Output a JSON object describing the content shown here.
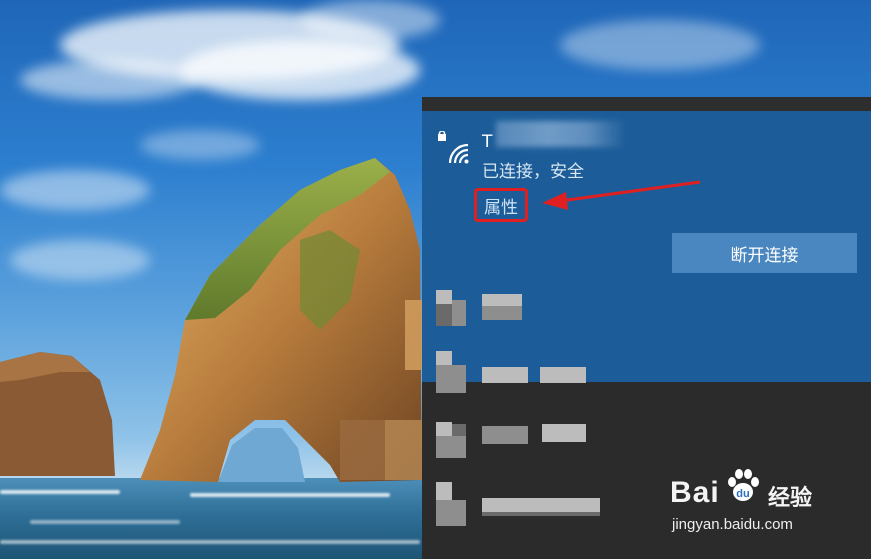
{
  "flyout": {
    "connected_network": {
      "ssid": "T",
      "status": "已连接，安全",
      "properties_label": "属性",
      "disconnect_label": "断开连接",
      "icon": "secured-wifi-icon"
    },
    "other_networks_count": 4
  },
  "colors": {
    "accent": "#1c5d99",
    "button": "#4a86bf",
    "flyout_bg": "#2b2b2b",
    "highlight": "#e02020"
  },
  "watermark": {
    "brand": "Bai",
    "brand_suffix": "经验",
    "url": "jingyan.baidu.com"
  }
}
